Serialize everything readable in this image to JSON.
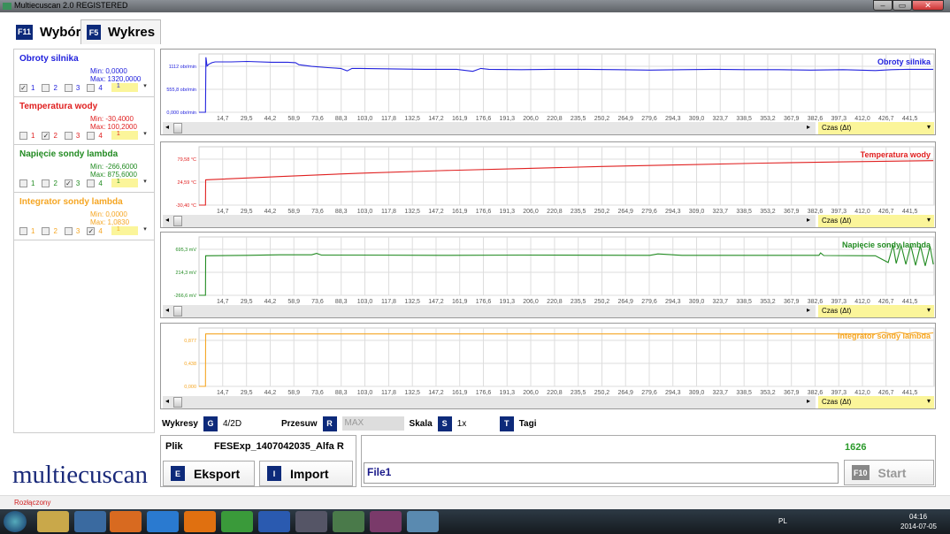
{
  "window": {
    "title": "Multiecuscan 2.0 REGISTERED",
    "min": "–",
    "max": "▭",
    "close": "✕"
  },
  "tabs": [
    {
      "key": "F11",
      "label": "Wybór"
    },
    {
      "key": "F5",
      "label": "Wykres"
    }
  ],
  "parameters": [
    {
      "name": "Obroty silnika",
      "min": "Min: 0,0000",
      "max": "Max: 1320,0000",
      "color": "#2222dd",
      "checked": 1,
      "sel": "1"
    },
    {
      "name": "Temperatura wody",
      "min": "Min: -30,4000",
      "max": "Max: 100,2000",
      "color": "#e02020",
      "checked": 2,
      "sel": "1"
    },
    {
      "name": "Napięcie sondy lambda",
      "min": "Min: -266,6000",
      "max": "Max: 875,6000",
      "color": "#228b22",
      "checked": 3,
      "sel": "1"
    },
    {
      "name": "Integrator sondy lambda",
      "min": "Min: 0,0000",
      "max": "Max: 1,0830",
      "color": "#f5a623",
      "checked": 4,
      "sel": "1"
    }
  ],
  "checkbox_labels": [
    "1",
    "2",
    "3",
    "4"
  ],
  "chart_data": [
    {
      "type": "line",
      "title": "Obroty silnika",
      "color": "#2222dd",
      "yticks": [
        "0,000 obr/min",
        "555,8 obr/min",
        "1112 obr/min"
      ],
      "ytick_values": [
        0,
        555.8,
        1112
      ],
      "x": [
        0,
        4,
        4.3,
        5,
        6,
        8,
        10,
        20,
        30,
        45,
        55,
        60,
        62,
        70,
        80,
        88,
        92,
        95,
        100,
        120,
        140,
        160,
        170,
        175,
        180,
        200,
        220,
        240,
        260,
        280,
        300,
        320,
        340,
        360,
        380,
        400,
        420,
        430,
        440,
        456
      ],
      "y": [
        0,
        0,
        1330,
        1120,
        1160,
        1200,
        1220,
        1220,
        1230,
        1210,
        1210,
        1200,
        1150,
        1110,
        1080,
        1060,
        1000,
        1060,
        1060,
        1050,
        1040,
        1040,
        990,
        1060,
        1040,
        1030,
        1040,
        1040,
        1030,
        1020,
        1030,
        1040,
        1030,
        1030,
        1020,
        1030,
        1010,
        1030,
        1040,
        1040
      ],
      "xlabel": "Czas (Δt)"
    },
    {
      "type": "line",
      "title": "Temperatura wody",
      "color": "#e02020",
      "yticks": [
        "-30,40 °C",
        "24,59 °C",
        "79,58 °C"
      ],
      "ytick_values": [
        -30.4,
        24.59,
        79.58
      ],
      "x": [
        0,
        4,
        4.1,
        50,
        100,
        150,
        200,
        250,
        300,
        350,
        400,
        456
      ],
      "y": [
        -30.4,
        -30.4,
        30,
        38,
        46,
        52,
        57,
        62,
        66,
        70,
        73,
        76
      ],
      "xlabel": "Czas (Δt)"
    },
    {
      "type": "line",
      "title": "Napięcie sondy lambda",
      "color": "#228b22",
      "yticks": [
        "-266,6 mV",
        "214,3 mV",
        "695,3 mV"
      ],
      "ytick_values": [
        -266.6,
        214.3,
        695.3
      ],
      "x": [
        0,
        4,
        4.1,
        30,
        50,
        70,
        73,
        76,
        100,
        150,
        200,
        280,
        285,
        300,
        385,
        386,
        388,
        420,
        428,
        431,
        433,
        436,
        439,
        442,
        445,
        448,
        451,
        454,
        456
      ],
      "y": [
        -266.6,
        -266.6,
        560,
        570,
        580,
        580,
        610,
        575,
        575,
        570,
        575,
        570,
        600,
        570,
        570,
        620,
        565,
        560,
        420,
        780,
        400,
        780,
        380,
        780,
        360,
        770,
        350,
        760,
        380
      ],
      "xlabel": "Czas (Δt)"
    },
    {
      "type": "line",
      "title": "Integrator sondy lambda",
      "color": "#f5a623",
      "yticks": [
        "0,000",
        "0,438",
        "0,877"
      ],
      "ytick_values": [
        0,
        0.438,
        0.877
      ],
      "x": [
        0,
        4,
        4.1,
        420,
        425,
        430,
        435,
        440,
        445,
        450,
        456
      ],
      "y": [
        0,
        0,
        1.0,
        1.0,
        1.03,
        1.0,
        1.03,
        1.0,
        1.03,
        1.0,
        1.02
      ],
      "xlabel": "Czas (Δt)"
    }
  ],
  "xticks": [
    "14,7",
    "29,5",
    "44,2",
    "58,9",
    "73,6",
    "88,3",
    "103,0",
    "117,8",
    "132,5",
    "147,2",
    "161,9",
    "176,6",
    "191,3",
    "206,0",
    "220,8",
    "235,5",
    "250,2",
    "264,9",
    "279,6",
    "294,3",
    "309,0",
    "323,7",
    "338,5",
    "353,2",
    "367,9",
    "382,6",
    "397,3",
    "412,0",
    "426,7",
    "441,5"
  ],
  "xtick_values": [
    14.7,
    29.5,
    44.2,
    58.9,
    73.6,
    88.3,
    103.0,
    117.8,
    132.5,
    147.2,
    161.9,
    176.6,
    191.3,
    206.0,
    220.8,
    235.5,
    250.2,
    264.9,
    279.6,
    294.3,
    309.0,
    323.7,
    338.5,
    353.2,
    367.9,
    382.6,
    397.3,
    412.0,
    426.7,
    441.5
  ],
  "toolbar": {
    "wykresy": "Wykresy",
    "wykresy_key": "G",
    "wykresy_val": "4/2D",
    "przesuw": "Przesuw",
    "przesuw_key": "R",
    "przesuw_val": "MAX",
    "skala": "Skala",
    "skala_key": "S",
    "skala_val": "1x",
    "tagi_key": "T",
    "tagi": "Tagi"
  },
  "file": {
    "label": "Plik",
    "value": "FESExp_1407042035_Alfa R",
    "export_key": "E",
    "export": "Eksport",
    "import_key": "I",
    "import": "Import"
  },
  "run": {
    "count": "1626",
    "input": "File1",
    "start_key": "F10",
    "start": "Start"
  },
  "logo": "multiecuscan",
  "status": "Rozłączony",
  "tray": {
    "lang": "PL",
    "time": "04:16",
    "date": "2014-07-05"
  }
}
